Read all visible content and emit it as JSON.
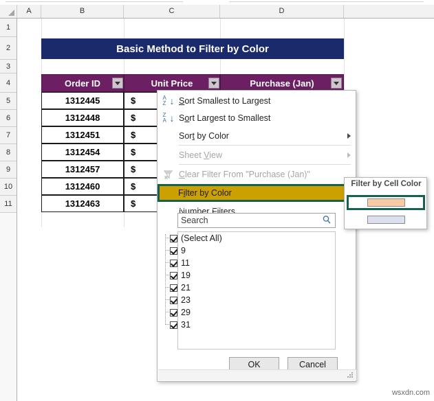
{
  "app": {
    "type": "spreadsheet",
    "watermark": "wsxdn.com"
  },
  "grid": {
    "column_headers": [
      "A",
      "B",
      "C",
      "D"
    ],
    "row_headers": [
      "1",
      "2",
      "3",
      "4",
      "5",
      "6",
      "7",
      "8",
      "9",
      "10",
      "11"
    ]
  },
  "title_banner": {
    "text": "Basic Method to Filter by Color",
    "background": "#1b2a6b",
    "color": "#ffffff"
  },
  "table": {
    "header_background": "#6d1f63",
    "headers": [
      {
        "label": "Order ID",
        "has_filter_button": true
      },
      {
        "label": "Unit Price",
        "has_filter_button": true
      },
      {
        "label": "Purchase (Jan)",
        "has_filter_button": true
      }
    ],
    "rows": [
      {
        "order_id": "1312445",
        "unit_price": "$"
      },
      {
        "order_id": "1312448",
        "unit_price": "$"
      },
      {
        "order_id": "1312451",
        "unit_price": "$"
      },
      {
        "order_id": "1312454",
        "unit_price": "$"
      },
      {
        "order_id": "1312457",
        "unit_price": "$"
      },
      {
        "order_id": "1312460",
        "unit_price": "$"
      },
      {
        "order_id": "1312463",
        "unit_price": "$"
      }
    ]
  },
  "filter_menu": {
    "items": [
      {
        "label": "Sort Smallest to Largest",
        "icon": "sort-ascending-icon",
        "disabled": false,
        "submenu": false
      },
      {
        "label": "Sort Largest to Smallest",
        "icon": "sort-descending-icon",
        "disabled": false,
        "submenu": false
      },
      {
        "label": "Sort by Color",
        "icon": "none",
        "disabled": false,
        "submenu": true
      },
      {
        "label": "Sheet View",
        "icon": "none",
        "disabled": true,
        "submenu": true
      },
      {
        "label": "Clear Filter From \"Purchase (Jan)\"",
        "icon": "clear-filter-icon",
        "disabled": true,
        "submenu": false
      },
      {
        "label": "Filter by Color",
        "icon": "none",
        "disabled": false,
        "submenu": true,
        "highlighted": true
      },
      {
        "label": "Number Filters",
        "icon": "none",
        "disabled": false,
        "submenu": true
      }
    ],
    "highlight_background": "#cca000",
    "highlight_border": "#15604f",
    "search": {
      "placeholder": "Search",
      "value": "",
      "icon": "search-icon"
    },
    "checkbox_list": [
      {
        "label": "(Select All)",
        "checked": true
      },
      {
        "label": "9",
        "checked": true
      },
      {
        "label": "11",
        "checked": true
      },
      {
        "label": "19",
        "checked": true
      },
      {
        "label": "21",
        "checked": true
      },
      {
        "label": "23",
        "checked": true
      },
      {
        "label": "29",
        "checked": true
      },
      {
        "label": "31",
        "checked": true
      }
    ],
    "buttons": {
      "ok": "OK",
      "cancel": "Cancel"
    }
  },
  "color_submenu": {
    "title": "Filter by Cell Color",
    "swatches": [
      {
        "color": "#f8cba6",
        "selected": true
      },
      {
        "color": "#dce0ef",
        "selected": false
      }
    ],
    "selection_border": "#15604f"
  }
}
